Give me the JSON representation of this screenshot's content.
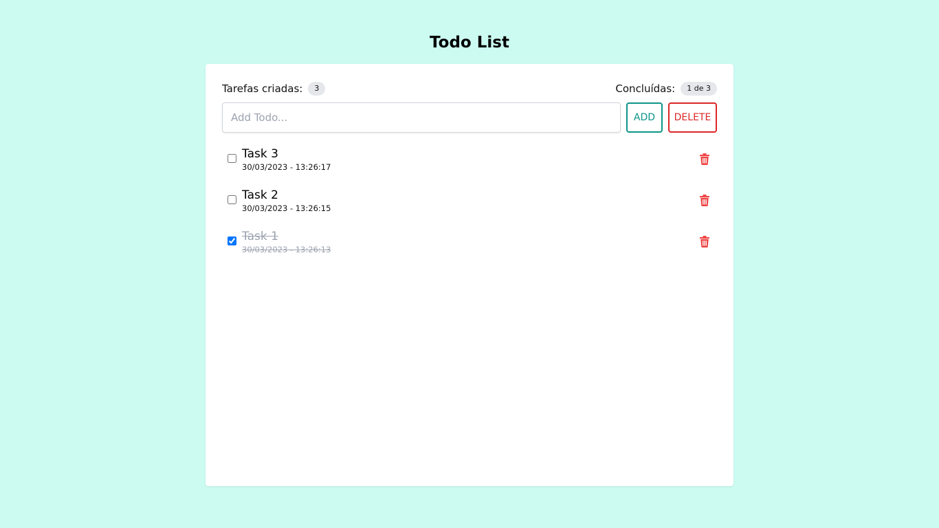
{
  "app": {
    "title": "Todo List"
  },
  "stats": {
    "created_label": "Tarefas criadas:",
    "created_count": "3",
    "completed_label": "Concluídas:",
    "completed_count": "1 de 3"
  },
  "form": {
    "placeholder": "Add Todo...",
    "value": "",
    "add_label": "ADD",
    "delete_label": "DELETE"
  },
  "todos": [
    {
      "title": "Task 3",
      "date": "30/03/2023 - 13:26:17",
      "done": false
    },
    {
      "title": "Task 2",
      "date": "30/03/2023 - 13:26:15",
      "done": false
    },
    {
      "title": "Task 1",
      "date": "30/03/2023 - 13:26:13",
      "done": true
    }
  ],
  "icons": {
    "delete": "trash-icon"
  },
  "colors": {
    "background": "#ccfbf1",
    "card": "#ffffff",
    "add_accent": "#0d9488",
    "delete_accent": "#dc2626",
    "trash_icon": "#ef4444",
    "checkbox_checked": "#2563eb"
  }
}
